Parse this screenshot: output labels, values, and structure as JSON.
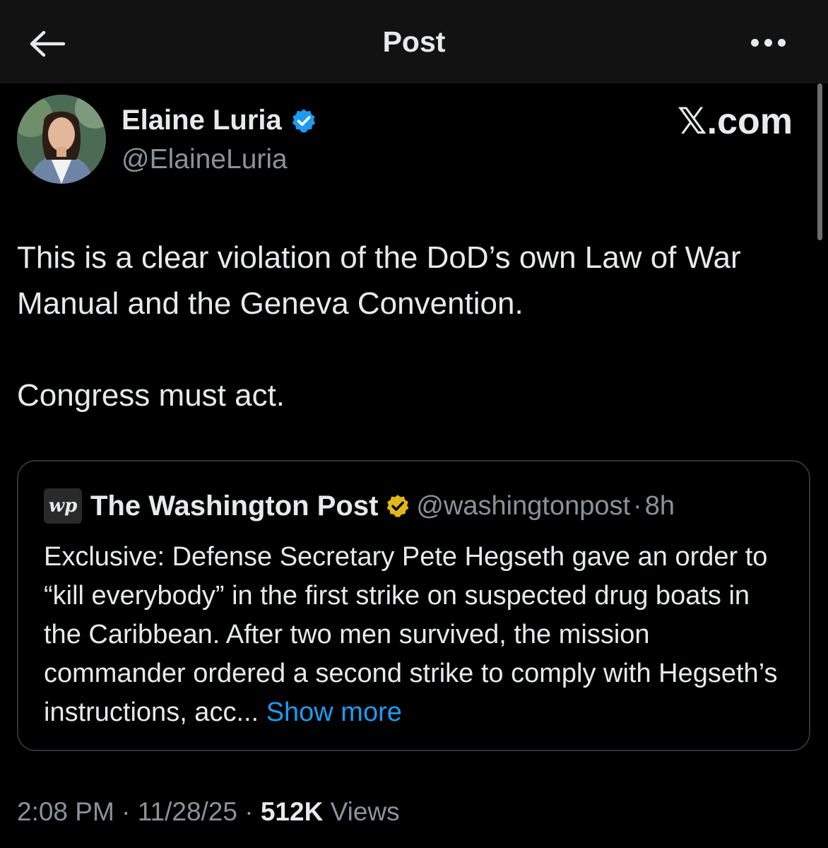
{
  "header": {
    "title": "Post",
    "back_icon": "arrow-left-icon",
    "more_icon": "more-horizontal-icon"
  },
  "post": {
    "author_name": "Elaine Luria",
    "author_handle": "@ElaineLuria",
    "verified_badge": "blue",
    "watermark": "𝕏.com",
    "paragraphs": [
      "This is a clear violation of the DoD’s own Law of War Manual and the Geneva Convention.",
      "Congress must act."
    ],
    "time": "2:08 PM",
    "date": "11/28/25",
    "views_count": "512K",
    "views_label": "Views"
  },
  "quote": {
    "logo_text": "wp",
    "name": "The Washington Post",
    "verified_badge": "gold",
    "handle": "@washingtonpost",
    "age": "8h",
    "text": "Exclusive: Defense Secretary Pete Hegseth gave an order to “kill everybody” in the first strike on suspected drug boats in the Caribbean. After two men survived, the mission commander ordered a second strike to comply with Hegseth’s instructions, acc...",
    "show_more": "Show more"
  },
  "colors": {
    "background": "#000000",
    "topbar": "#121212",
    "link": "#1d9bf0",
    "secondary_text": "#8b9298",
    "verified_blue": "#1d9bf0",
    "verified_gold": "#e2b719"
  }
}
